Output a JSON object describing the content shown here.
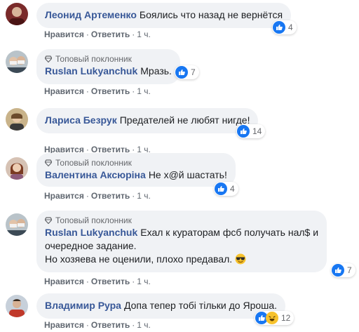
{
  "actions": {
    "like": "Нравится",
    "reply": "Ответить",
    "time": "1 ч.",
    "sep": "·"
  },
  "badge_label": "Топовый поклонник",
  "colors": {
    "bubble": "#f0f2f5",
    "author": "#385898",
    "like_blue": "#1877f2",
    "haha_yellow": "#f7c22c"
  },
  "comments": [
    {
      "author": "Леонид Артеменко",
      "text": "Боялись что назад не вернётся",
      "reaction_count": "4",
      "reaction_icons": [
        "like-icon"
      ]
    },
    {
      "author": "Ruslan Lukyanchuk",
      "badge": true,
      "text": "Мразь.",
      "reaction_count": "7",
      "reaction_icons": [
        "like-icon"
      ]
    },
    {
      "author": "Лариса Безрук",
      "text": "Предателей не любят нигде!",
      "reaction_count": "14",
      "reaction_icons": [
        "like-icon"
      ]
    },
    {
      "author": "Валентина Аксюріна",
      "badge": true,
      "text": "Не х@й шастать!",
      "reaction_count": "4",
      "reaction_icons": [
        "like-icon"
      ]
    },
    {
      "author": "Ruslan Lukyanchuk",
      "badge": true,
      "text": "Ехал к кураторам фсб получать нал$ и",
      "text_line2": "очередное задание.",
      "text_line3": "Но хозяева не оценили, плохо предавал.",
      "emoji": "sunglasses-emoji",
      "reaction_count": "7",
      "reaction_icons": [
        "like-icon"
      ]
    },
    {
      "author": "Владимир Рура",
      "text": "Допа тепер тобі тільки до Яроша.",
      "reaction_count": "12",
      "reaction_icons": [
        "like-icon",
        "haha-icon"
      ]
    }
  ]
}
